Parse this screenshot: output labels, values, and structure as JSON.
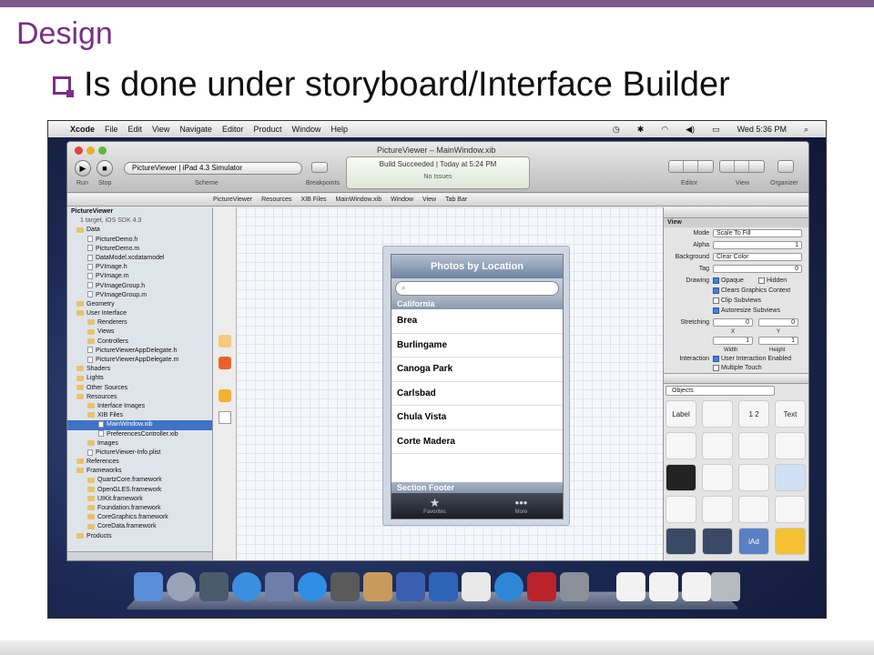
{
  "slide": {
    "title": "Design",
    "bullet": "Is done under storyboard/Interface Builder"
  },
  "menubar": {
    "apple": "",
    "items": [
      "Xcode",
      "File",
      "Edit",
      "View",
      "Navigate",
      "Editor",
      "Product",
      "Window",
      "Help"
    ],
    "clock": "Wed 5:36 PM"
  },
  "window": {
    "title": "PictureViewer – MainWindow.xib",
    "scheme": "PictureViewer | iPad 4.3 Simulator",
    "run_label": "Run",
    "stop_label": "Stop",
    "scheme_label": "Scheme",
    "breakpoints_label": "Breakpoints",
    "status_line": "Build Succeeded | Today at 5:24 PM",
    "status_sub": "No Issues",
    "editor_label": "Editor",
    "view_label": "View",
    "organizer_label": "Organizer"
  },
  "jumpbar": {
    "crumbs": [
      "PictureViewer",
      "Resources",
      "XIB Files",
      "MainWindow.xib",
      "Window",
      "View",
      "Tab Bar"
    ]
  },
  "navigator": {
    "items": [
      "PictureViewer",
      "1 target, iOS SDK 4.3",
      "Data",
      "PictureDemo.h",
      "PictureDemo.m",
      "DataModel.xcdatamodel",
      "PVImage.h",
      "PVImage.m",
      "PVImageGroup.h",
      "PVImageGroup.m",
      "Geometry",
      "User Interface",
      "Renderers",
      "Views",
      "Controllers",
      "PictureViewerAppDelegate.h",
      "PictureViewerAppDelegate.m",
      "Shaders",
      "Lights",
      "Other Sources",
      "Resources",
      "Interface Images",
      "XIB Files",
      "MainWindow.xib",
      "PreferencesController.xib",
      "Images",
      "PictureViewer-Info.plist",
      "References",
      "Frameworks",
      "QuartzCore.framework",
      "OpenGLES.framework",
      "UIKit.framework",
      "Foundation.framework",
      "CoreGraphics.framework",
      "CoreData.framework",
      "Products"
    ]
  },
  "phone": {
    "nav_title": "Photos by Location",
    "section_header": "California",
    "rows": [
      "Brea",
      "Burlingame",
      "Canoga Park",
      "Carlsbad",
      "Chula Vista",
      "Corte Madera"
    ],
    "section_footer": "Section Footer",
    "tabs": [
      "Favorites",
      "More"
    ]
  },
  "inspector": {
    "section": "View",
    "mode_label": "Mode",
    "mode_value": "Scale To Fill",
    "alpha_label": "Alpha",
    "alpha_value": "1",
    "background_label": "Background",
    "background_value": "Clear Color",
    "tag_label": "Tag",
    "tag_value": "0",
    "drawing_label": "Drawing",
    "opaque": "Opaque",
    "hidden": "Hidden",
    "clears": "Clears Graphics Context",
    "clip": "Clip Subviews",
    "autoresize": "Autoresize Subviews",
    "stretching_label": "Stretching",
    "x_label": "X",
    "y_label": "Y",
    "width_label": "Width",
    "height_label": "Height",
    "stretch_x": "0",
    "stretch_y": "0",
    "stretch_w": "1",
    "stretch_h": "1",
    "interaction_label": "Interaction",
    "user_interaction": "User Interaction Enabled",
    "multiple_touch": "Multiple Touch",
    "library_selector": "Objects",
    "library": [
      "Label",
      "",
      "1 2",
      "Text",
      "",
      "",
      "",
      "",
      "",
      "",
      "",
      "",
      "",
      "",
      "",
      "",
      "",
      "",
      "iAd",
      ""
    ]
  },
  "colors": {
    "title": "#7a2f86",
    "accent_bar": "#7b5a8c",
    "selection": "#3f73c6"
  }
}
